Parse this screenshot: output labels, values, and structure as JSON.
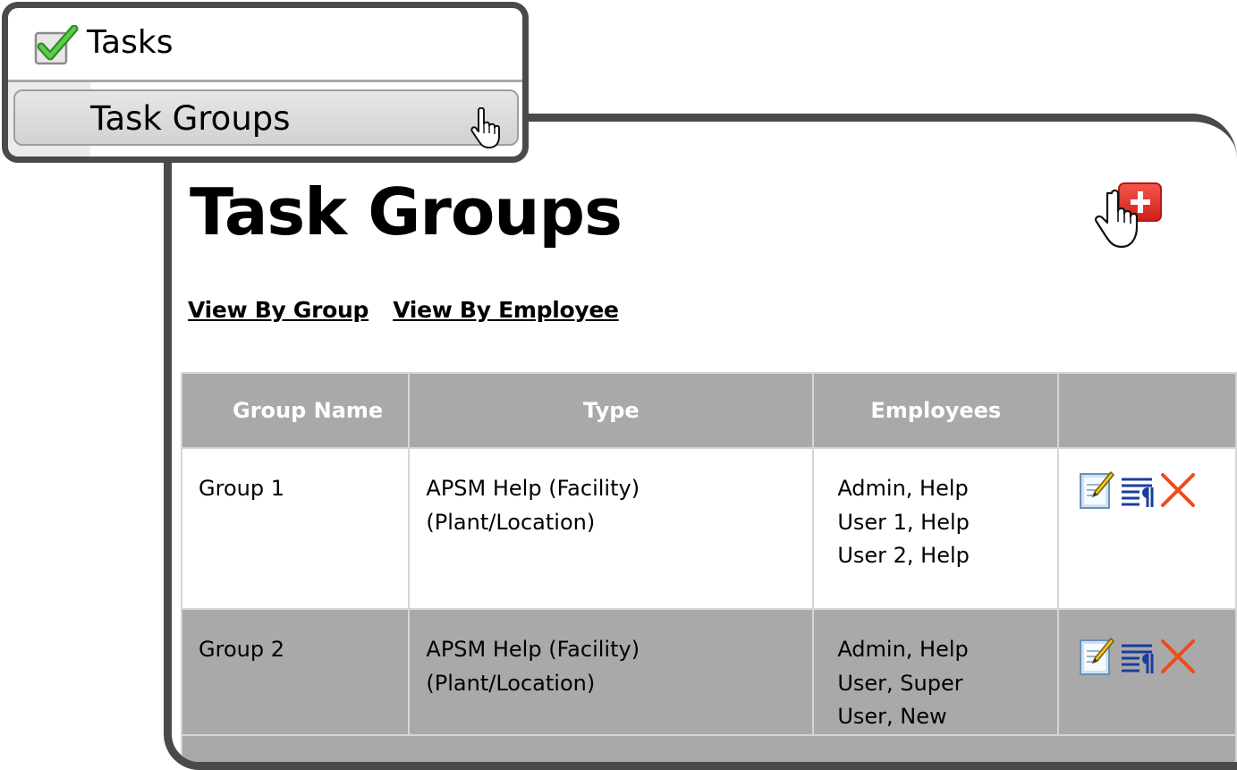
{
  "menu": {
    "header_label": "Tasks",
    "items": [
      {
        "label": "Task Groups"
      }
    ]
  },
  "page": {
    "title": "Task Groups",
    "links": [
      "View By Group",
      "View By Employee"
    ]
  },
  "table": {
    "columns": [
      "Group Name",
      "Type",
      "Employees",
      ""
    ],
    "rows": [
      {
        "name": "Group 1",
        "type": "APSM Help (Facility) (Plant/Location)",
        "employees": [
          "Admin, Help",
          "User 1, Help",
          "User 2, Help"
        ]
      },
      {
        "name": "Group 2",
        "type": "APSM Help (Facility) (Plant/Location)",
        "employees": [
          "Admin, Help",
          "User, Super",
          "User, New"
        ]
      }
    ]
  },
  "icons": {
    "menu_header": "checkbox-checked-icon",
    "menu_cursor": "hand-pointer-icon",
    "add": "add-plus-icon",
    "row_actions": [
      "edit-icon",
      "details-icon",
      "delete-icon"
    ]
  },
  "colors": {
    "frame_border": "#4a4a4a",
    "header_gray": "#a9a9a9",
    "add_red": "#e8322a",
    "delete_red": "#ee4b1c",
    "details_blue": "#1a3e9e",
    "check_green": "#3aa632"
  }
}
